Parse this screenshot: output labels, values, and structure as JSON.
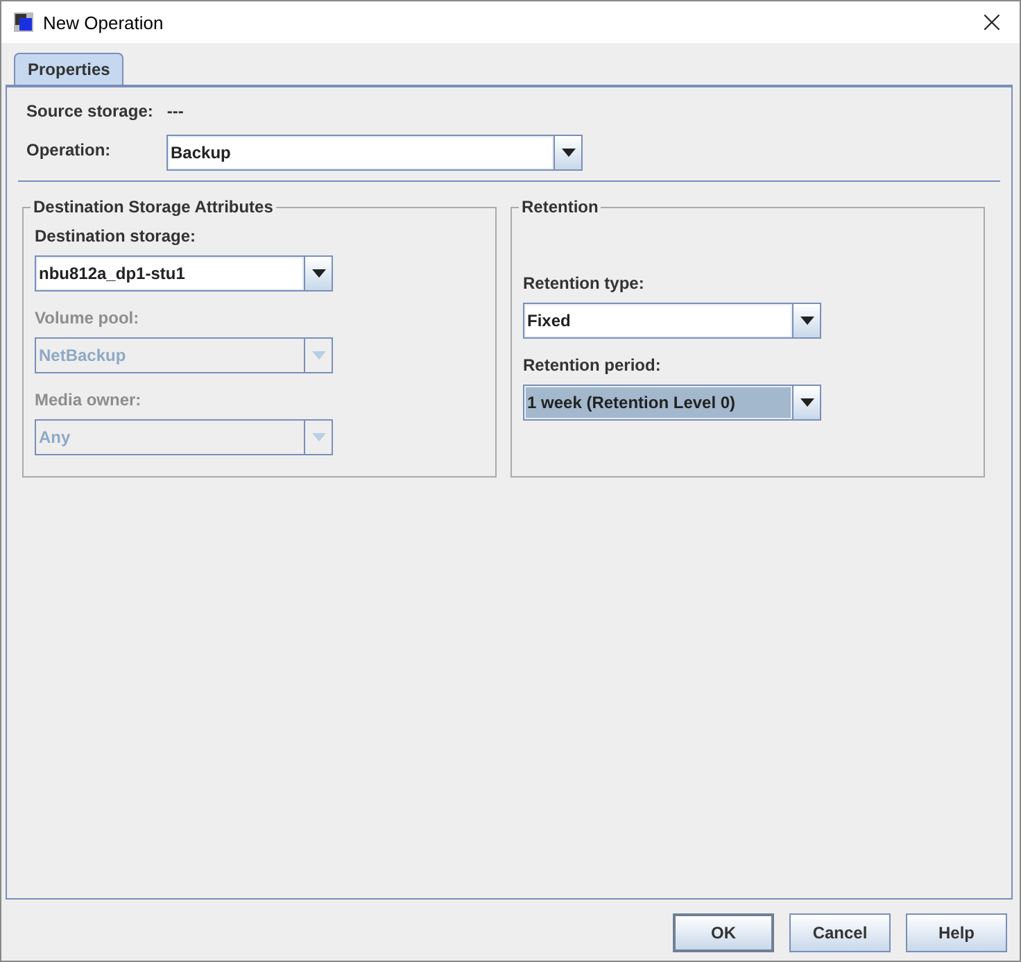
{
  "window": {
    "title": "New Operation",
    "close": "×"
  },
  "tabs": [
    {
      "label": "Properties",
      "selected": true
    }
  ],
  "source_storage": {
    "label": "Source storage:",
    "value": "---"
  },
  "operation": {
    "label": "Operation:",
    "value": "Backup",
    "disabled": false,
    "highlighted": false
  },
  "groups": [
    {
      "title": "Destination Storage Attributes",
      "fields": [
        {
          "label": "Destination storage:",
          "value": "nbu812a_dp1-stu1",
          "disabled": false,
          "highlighted": false
        },
        {
          "label": "Volume pool:",
          "value": "NetBackup",
          "disabled": true,
          "highlighted": false
        },
        {
          "label": "Media owner:",
          "value": "Any",
          "disabled": true,
          "highlighted": false
        }
      ]
    },
    {
      "title": "Retention",
      "fields": [
        {
          "label": "Retention type:",
          "value": "Fixed",
          "disabled": false,
          "highlighted": false
        },
        {
          "label": "Retention period:",
          "value": "1 week (Retention Level 0)",
          "disabled": false,
          "highlighted": true
        }
      ]
    }
  ],
  "buttons": [
    {
      "label": "OK",
      "default": true
    },
    {
      "label": "Cancel",
      "default": false
    },
    {
      "label": "Help",
      "default": false
    }
  ]
}
